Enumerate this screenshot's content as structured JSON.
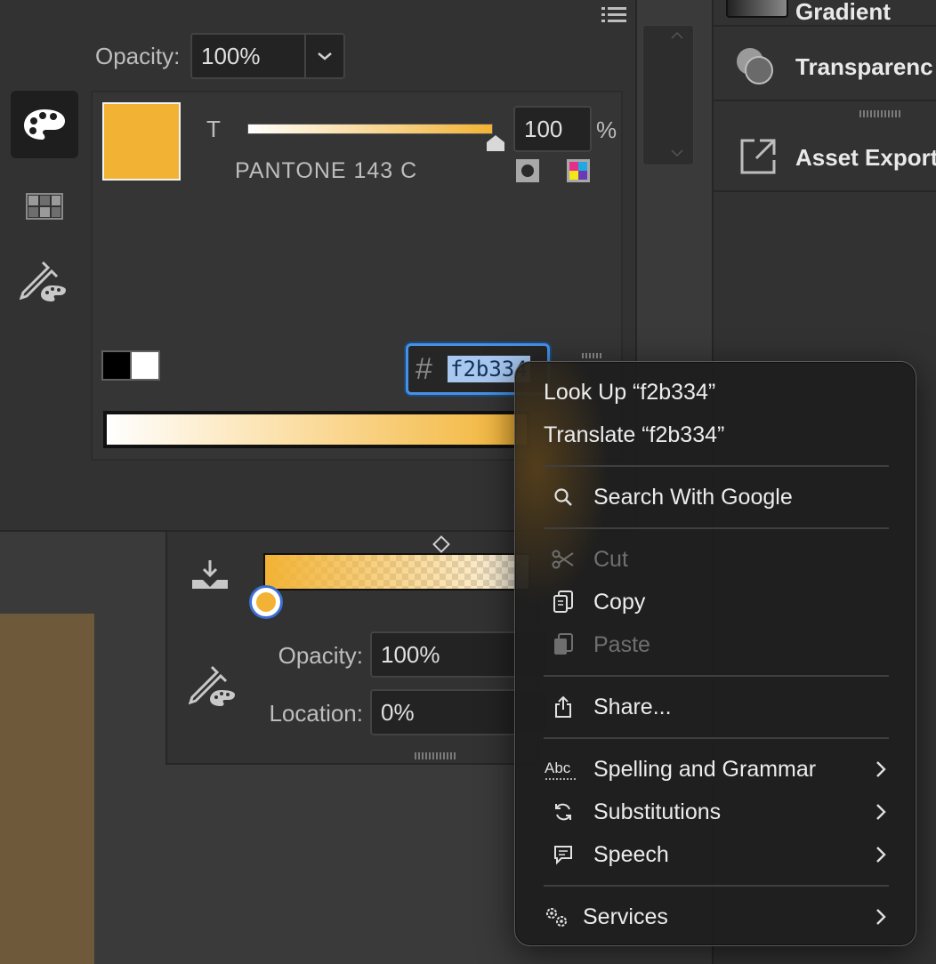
{
  "color_panel": {
    "opacity_label": "Opacity:",
    "opacity_value": "100%",
    "swatch_color": "#f2b334",
    "tint_letter": "T",
    "tint_value": "100",
    "tint_unit": "%",
    "swatch_name": "PANTONE 143 C",
    "hex_prefix": "#",
    "hex_value": "f2b334"
  },
  "right_dock": {
    "gradient_label": "Gradient",
    "transparency_label": "Transparenc",
    "asset_export_label": "Asset Export"
  },
  "gradient_panel": {
    "opacity_label": "Opacity:",
    "opacity_value": "100%",
    "location_label": "Location:",
    "location_value": "0%"
  },
  "context_menu": {
    "look_up": "Look Up “f2b334”",
    "translate": "Translate “f2b334”",
    "search_google": "Search With Google",
    "cut": "Cut",
    "copy": "Copy",
    "paste": "Paste",
    "share": "Share...",
    "spelling": "Spelling and Grammar",
    "substitutions": "Substitutions",
    "speech": "Speech",
    "services": "Services"
  },
  "colors": {
    "accent_orange": "#f2b334",
    "selection_blue": "#4a90e2"
  }
}
